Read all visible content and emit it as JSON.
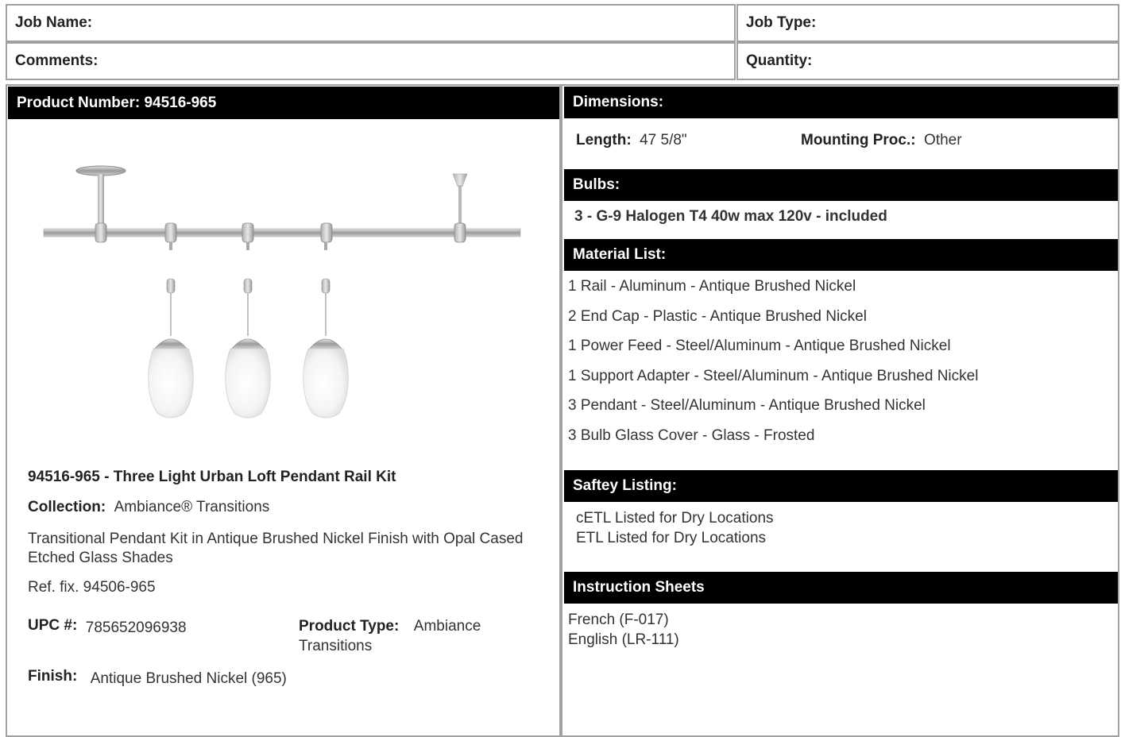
{
  "job": {
    "name_label": "Job Name:",
    "type_label": "Job Type:",
    "comments_label": "Comments:",
    "quantity_label": "Quantity:"
  },
  "product": {
    "header": "Product Number: 94516-965",
    "title": "94516-965 - Three Light Urban Loft Pendant Rail Kit",
    "collection_label": "Collection:",
    "collection_value": "Ambiance® Transitions",
    "description": "Transitional Pendant Kit in Antique Brushed Nickel Finish with Opal Cased Etched Glass Shades",
    "ref": "Ref. fix. 94506-965",
    "upc_label": "UPC #:",
    "upc_value": "785652096938",
    "type_label": "Product Type:",
    "type_value_1": "Ambiance",
    "type_value_2": "Transitions",
    "finish_label": "Finish:",
    "finish_value": "Antique Brushed Nickel (965)"
  },
  "dimensions": {
    "header": "Dimensions:",
    "length_label": "Length:",
    "length_value": "47 5/8\"",
    "mounting_label": "Mounting Proc.:",
    "mounting_value": "Other"
  },
  "bulbs": {
    "header": "Bulbs:",
    "value": "3 - G-9 Halogen T4 40w max 120v - included"
  },
  "materials": {
    "header": "Material List:",
    "items": [
      "1 Rail - Aluminum - Antique Brushed Nickel",
      "2 End Cap - Plastic - Antique Brushed Nickel",
      "1 Power Feed - Steel/Aluminum - Antique Brushed Nickel",
      "1 Support Adapter - Steel/Aluminum - Antique Brushed Nickel",
      "3 Pendant - Steel/Aluminum - Antique Brushed Nickel",
      "3 Bulb Glass Cover - Glass - Frosted"
    ]
  },
  "safety": {
    "header": "Saftey Listing:",
    "items": [
      "cETL Listed for Dry Locations",
      "ETL Listed for Dry Locations"
    ]
  },
  "instructions": {
    "header": "Instruction Sheets",
    "items": [
      "French (F-017)",
      "English (LR-111)"
    ]
  },
  "colors": {
    "border": "#a0a0a0",
    "bar": "#000000",
    "text": "#222222"
  }
}
